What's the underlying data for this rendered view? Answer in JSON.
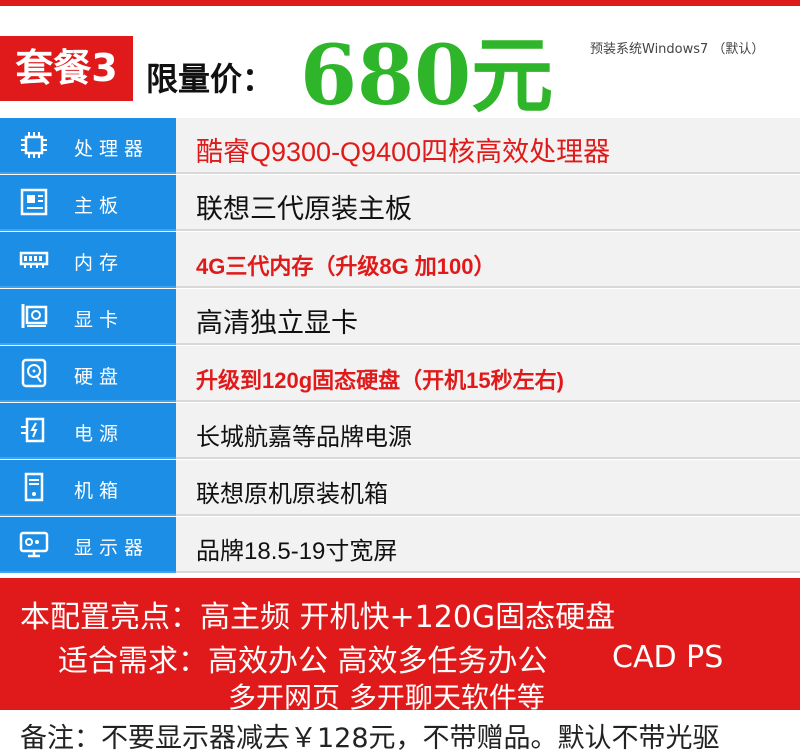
{
  "header": {
    "package_label": "套餐3",
    "price_label": "限量价：",
    "price_value": "680元",
    "os_note": "预装系统Windows7 （默认）"
  },
  "specs": [
    {
      "icon": "cpu-icon",
      "label": "处理器",
      "value": "酷睿Q9300-Q9400四核高效处理器"
    },
    {
      "icon": "motherboard-icon",
      "label": "主板",
      "value": "联想三代原装主板"
    },
    {
      "icon": "memory-icon",
      "label": "内存",
      "value": "4G三代内存（升级8G 加100）"
    },
    {
      "icon": "graphics-card-icon",
      "label": "显卡",
      "value": "高清独立显卡"
    },
    {
      "icon": "hard-disk-icon",
      "label": "硬盘",
      "value": "升级到120g固态硬盘（开机15秒左右)"
    },
    {
      "icon": "power-supply-icon",
      "label": "电源",
      "value": "长城航嘉等品牌电源"
    },
    {
      "icon": "case-icon",
      "label": "机箱",
      "value": "联想原机原装机箱"
    },
    {
      "icon": "monitor-icon",
      "label": "显示器",
      "value": "品牌18.5-19寸宽屏"
    }
  ],
  "highlights": {
    "line1": "本配置亮点：高主频 开机快+120G固态硬盘",
    "line2": "适合需求：高效办公 高效多任务办公",
    "line2_extra": "CAD PS",
    "line3": "多开网页 多开聊天软件等"
  },
  "remark": "备注：不要显示器减去￥128元，不带赠品。默认不带光驱",
  "colors": {
    "red": "#e01a1a",
    "blue": "#1c8ee5",
    "green": "#2fb52a"
  }
}
